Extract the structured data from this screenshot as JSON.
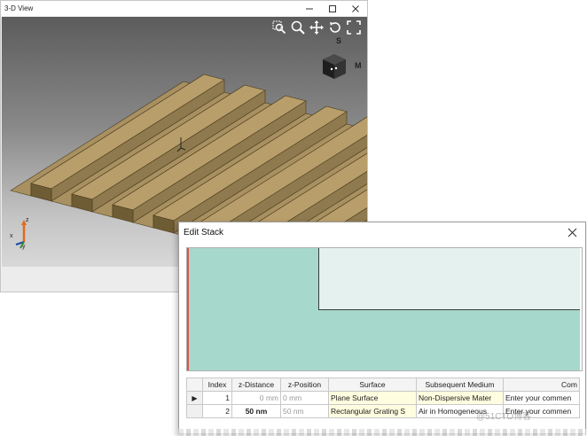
{
  "view3d": {
    "title": "3-D View",
    "controls": [
      "minimize-icon",
      "maximize-icon",
      "close-icon"
    ],
    "toolbar": [
      "zoom-region-icon",
      "zoom-icon",
      "pan-icon",
      "rotate-icon",
      "fit-all-icon"
    ],
    "cube_labels": {
      "top": "S",
      "right": "M"
    },
    "axis_labels": {
      "z": "z",
      "x": "x",
      "y": "y"
    },
    "colors": {
      "grating": "#a89060",
      "grating_edge": "#4a3a1e",
      "axis_z": "#e06a1e",
      "axis_x": "#1e4aa0"
    }
  },
  "edit_stack": {
    "title": "Edit Stack",
    "preview": {
      "base_color": "#a6d8cc",
      "top_color": "#e4f1ee",
      "marker_color": "#d9534f"
    },
    "columns": [
      "",
      "Index",
      "z-Distance",
      "z-Position",
      "Surface",
      "Subsequent Medium",
      "Com"
    ],
    "rows": [
      {
        "marker": "▶",
        "index": "1",
        "z_distance": "0 mm",
        "z_position": "0 mm",
        "surface": "Plane Surface",
        "medium": "Non-Dispersive Mater",
        "comment": "Enter your commen"
      },
      {
        "marker": "",
        "index": "2",
        "z_distance": "50 nm",
        "z_position": "50 nm",
        "surface": "Rectangular Grating S",
        "medium": "Air in Homogeneous",
        "comment": "Enter your commen"
      }
    ]
  },
  "watermark": "@51CTO博客"
}
